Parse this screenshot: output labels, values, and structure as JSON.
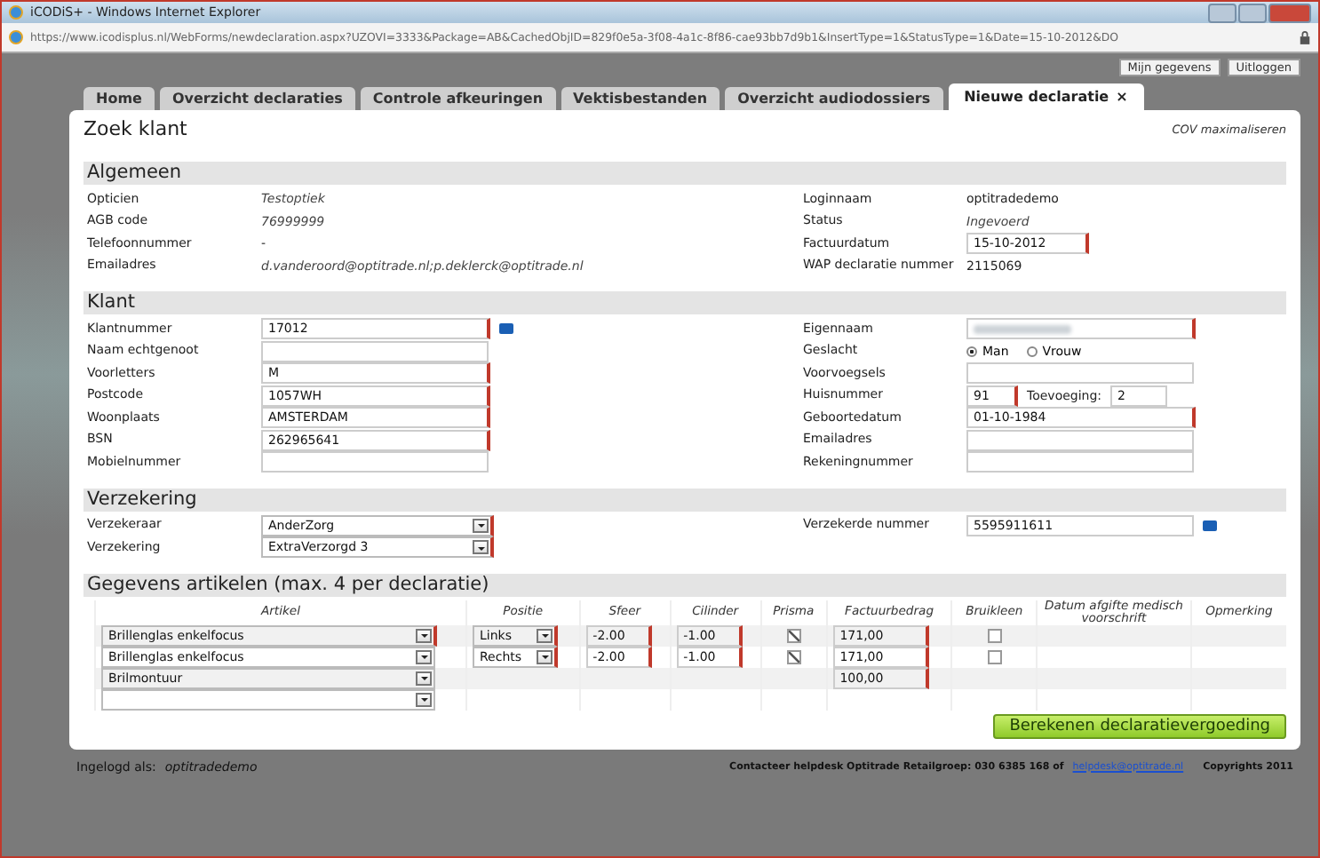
{
  "window": {
    "title": "iCODiS+ - Windows Internet Explorer"
  },
  "address": {
    "url": "https://www.icodisplus.nl/WebForms/newdeclaration.aspx?UZOVI=3333&Package=AB&CachedObjID=829f0e5a-3f08-4a1c-8f86-cae93bb7d9b1&InsertType=1&StatusType=1&Date=15-10-2012&DO"
  },
  "header_links": [
    "Mijn gegevens",
    "Uitloggen"
  ],
  "tabs": [
    {
      "label": "Home",
      "selected": false,
      "closable": false
    },
    {
      "label": "Overzicht declaraties",
      "selected": false,
      "closable": false
    },
    {
      "label": "Controle afkeuringen",
      "selected": false,
      "closable": false
    },
    {
      "label": "Vektisbestanden",
      "selected": false,
      "closable": false
    },
    {
      "label": "Overzicht audiodossiers",
      "selected": false,
      "closable": false
    },
    {
      "label": "Nieuwe declaratie",
      "selected": true,
      "closable": true,
      "close": "×"
    }
  ],
  "page": {
    "title": "Zoek klant",
    "link": "COV maximaliseren"
  },
  "sections": [
    {
      "title": "Algemeen",
      "left": [
        {
          "label": "Opticien",
          "kind": "italic",
          "value": "Testoptiek"
        },
        {
          "label": "AGB code",
          "kind": "italic",
          "value": "76999999"
        },
        {
          "label": "Telefoonnummer",
          "kind": "text",
          "value": "-"
        },
        {
          "label": "Emailadres",
          "kind": "italic",
          "value": "d.vanderoord@optitrade.nl;p.deklerck@optitrade.nl"
        }
      ],
      "right": [
        {
          "label": "Loginnaam",
          "kind": "text",
          "value": "optitradedemo"
        },
        {
          "label": "Status",
          "kind": "italic",
          "value": "Ingevoerd"
        },
        {
          "label": "Factuurdatum",
          "kind": "short_input",
          "value": "15-10-2012",
          "required": true
        },
        {
          "label": "WAP declaratie nummer",
          "kind": "text",
          "value": "2115069"
        }
      ]
    },
    {
      "title": "Klant",
      "left": [
        {
          "label": "Klantnummer",
          "kind": "input",
          "value": "17012",
          "required": true,
          "info": true
        },
        {
          "label": "Naam echtgenoot",
          "kind": "input"
        },
        {
          "label": "Voorletters",
          "kind": "input",
          "value": "M",
          "required": true
        },
        {
          "label": "Postcode",
          "kind": "input",
          "value": "1057WH",
          "required": true
        },
        {
          "label": "Woonplaats",
          "kind": "input",
          "value": "AMSTERDAM",
          "required": true
        },
        {
          "label": "BSN",
          "kind": "input",
          "value": "262965641",
          "required": true
        },
        {
          "label": "Mobielnummer",
          "kind": "input"
        }
      ],
      "right": [
        {
          "label": "Eigennaam",
          "kind": "blurred",
          "required": true
        },
        {
          "label": "Geslacht",
          "kind": "radio",
          "options": [
            {
              "label": "Man",
              "selected": true
            },
            {
              "label": "Vrouw",
              "selected": false
            }
          ]
        },
        {
          "label": "Voorvoegsels",
          "kind": "input"
        },
        {
          "label": "Huisnummer",
          "kind": "pair",
          "value": "91",
          "required": true,
          "extra_label": "Toevoeging:",
          "extra_value": "2"
        },
        {
          "label": "Geboortedatum",
          "kind": "input",
          "value": "01-10-1984",
          "required": true
        },
        {
          "label": "Emailadres",
          "kind": "input"
        },
        {
          "label": "Rekeningnummer",
          "kind": "input"
        }
      ]
    },
    {
      "title": "Verzekering",
      "left": [
        {
          "label": "Verzekeraar",
          "kind": "select",
          "value": "AnderZorg",
          "required": true
        },
        {
          "label": "Verzekering",
          "kind": "select",
          "value": "ExtraVerzorgd 3",
          "required": true
        }
      ],
      "right": [
        {
          "label": "Verzekerde nummer",
          "kind": "input",
          "value": "5595911611",
          "info": true
        }
      ]
    }
  ],
  "articles": {
    "title": "Gegevens artikelen (max. 4 per declaratie)",
    "columns": [
      "Artikel",
      "Positie",
      "Sfeer",
      "Cilinder",
      "Prisma",
      "Factuurbedrag",
      "Bruikleen",
      "Datum afgifte medisch voorschrift",
      "Opmerking"
    ],
    "rows": [
      {
        "artikel": "Brillenglas enkelfocus",
        "artikel_required": true,
        "positie": "Links",
        "sfeer": "-2.00",
        "cilinder": "-1.00",
        "prisma": true,
        "factuurbedrag": "171,00",
        "bruikleen": false
      },
      {
        "artikel": "Brillenglas enkelfocus",
        "artikel_required": false,
        "positie": "Rechts",
        "sfeer": "-2.00",
        "cilinder": "-1.00",
        "prisma": true,
        "factuurbedrag": "171,00",
        "bruikleen": false
      },
      {
        "artikel": "Brilmontuur",
        "artikel_required": false,
        "factuurbedrag": "100,00"
      },
      {
        "artikel_required": false
      }
    ],
    "button": "Berekenen declaratievergoeding"
  },
  "footer": {
    "logged_in_label": "Ingelogd als:",
    "user": "optitradedemo",
    "contact": "Contacteer helpdesk Optitrade Retailgroep: 030 6385 168 of",
    "email": "helpdesk@optitrade.nl",
    "copyright": "Copyrights 2011"
  }
}
